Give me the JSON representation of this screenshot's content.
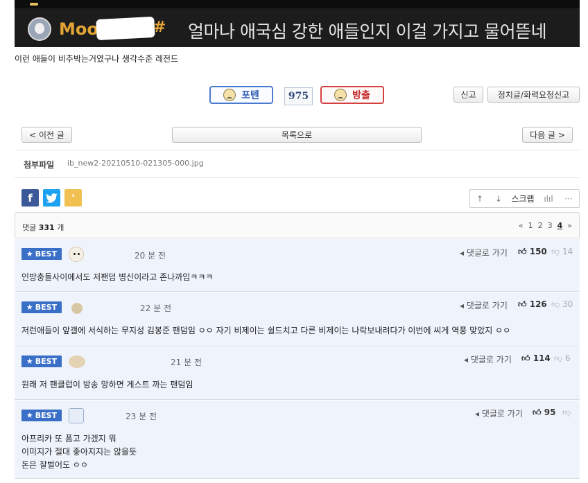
{
  "banner": {
    "nick": "Moo",
    "hash": "#",
    "title": "얼마나 애국심 강한 애들인지 이걸 가지고 물어뜯네"
  },
  "caption": "이런 애들이 비추박는거였구나 생각수준 레전드",
  "vote": {
    "up_label": "포텐",
    "count": "975",
    "down_label": "방출"
  },
  "actions": {
    "report": "신고",
    "report_politics": "정치글/화력요청신고"
  },
  "nav": {
    "prev": "< 이전 글",
    "list": "목록으로",
    "next": "다음 글 >"
  },
  "attachment": {
    "label": "첨부파일",
    "file": "ib_new2-20210510-021305-000.jpg"
  },
  "share": {
    "facebook": "f",
    "twitter": "t",
    "kakao": "'"
  },
  "tools": {
    "up": "↑",
    "down": "↓",
    "scrap": "스크랩",
    "chart": "ılıl",
    "more": "···"
  },
  "comments_bar": {
    "prefix": "댓글",
    "count": "331",
    "suffix": "개"
  },
  "pager": {
    "prev": "«",
    "pages": [
      "1",
      "2",
      "3",
      "4"
    ],
    "current": "4",
    "next": "»"
  },
  "best_label": "BEST",
  "comments": [
    {
      "time": "20 분 전",
      "reply": "댓글로 가기",
      "up": "150",
      "down": "14",
      "lines": [
        "인방충들사이에서도 저팬덤 병신이라고 존나까임ㅋㅋㅋ"
      ]
    },
    {
      "time": "22 분 전",
      "reply": "댓글로 가기",
      "up": "126",
      "down": "30",
      "lines": [
        "저런애들이 앞갤에 서식하는 무지성 김봉준 팬덤임 ㅇㅇ 자기 비제이는 쉴드치고 다른 비제이는 나락보내려다가 이번에 씨게 역풍 맞았지 ㅇㅇ"
      ]
    },
    {
      "time": "21 분 전",
      "reply": "댓글로 가기",
      "up": "114",
      "down": "6",
      "lines": [
        "원래 저 팬클럽이 방송 망하면 게스트 까는 팬덤임"
      ]
    },
    {
      "time": "23 분 전",
      "reply": "댓글로 가기",
      "up": "95",
      "down": "",
      "lines": [
        "아프리카 또 폼고 가겠지 뭐",
        "이미지가 절대 좋아지지는 않을듯",
        "돈은 잘벌어도 ㅇㅇ"
      ]
    }
  ]
}
